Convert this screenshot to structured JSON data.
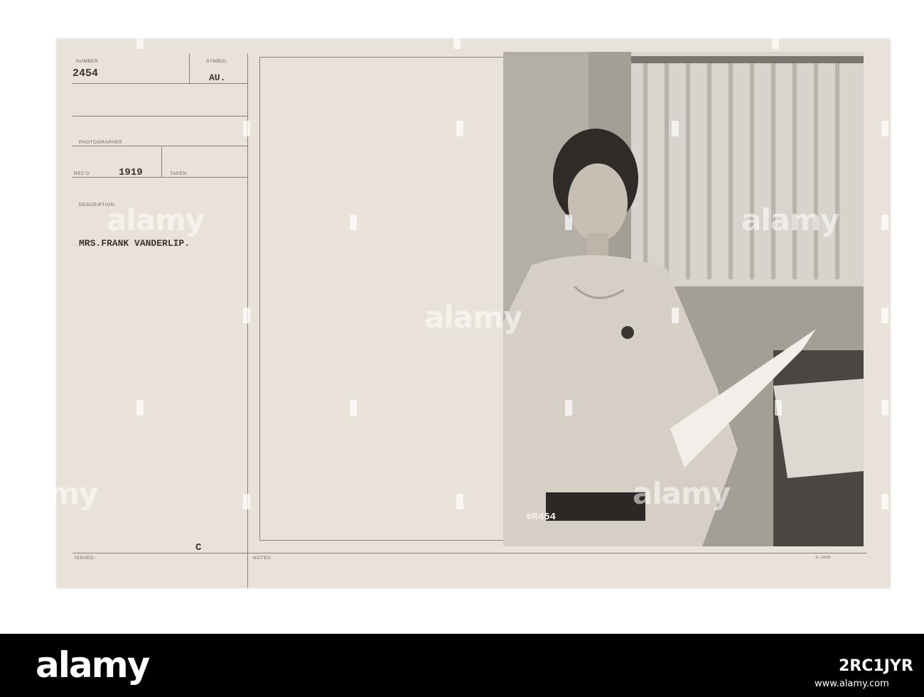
{
  "card": {
    "number_label": "NUMBER",
    "number_value": "2454",
    "symbol_label": "SYMBOL",
    "symbol_value": "AU.",
    "photographer_label": "PHOTOGRAPHER",
    "recd_label": "REC'D",
    "recd_value": "1919",
    "taken_label": "TAKEN",
    "description_label": "DESCRIPTION:",
    "description_value": "MRS.FRANK VANDERLIP.",
    "issued_label": "ISSUED:",
    "issued_mark": "C",
    "notes_label": "NOTES:",
    "form_code": "3—3600"
  },
  "photo": {
    "negative_number": "⊗R454"
  },
  "watermark": {
    "text": "alamy"
  },
  "credit": {
    "logo": "alamy",
    "image_id": "2RC1JYR",
    "url": "www.alamy.com"
  },
  "colors": {
    "card": "#e9e2d8",
    "rule": "#8a8178",
    "credit_bar": "#000000"
  }
}
